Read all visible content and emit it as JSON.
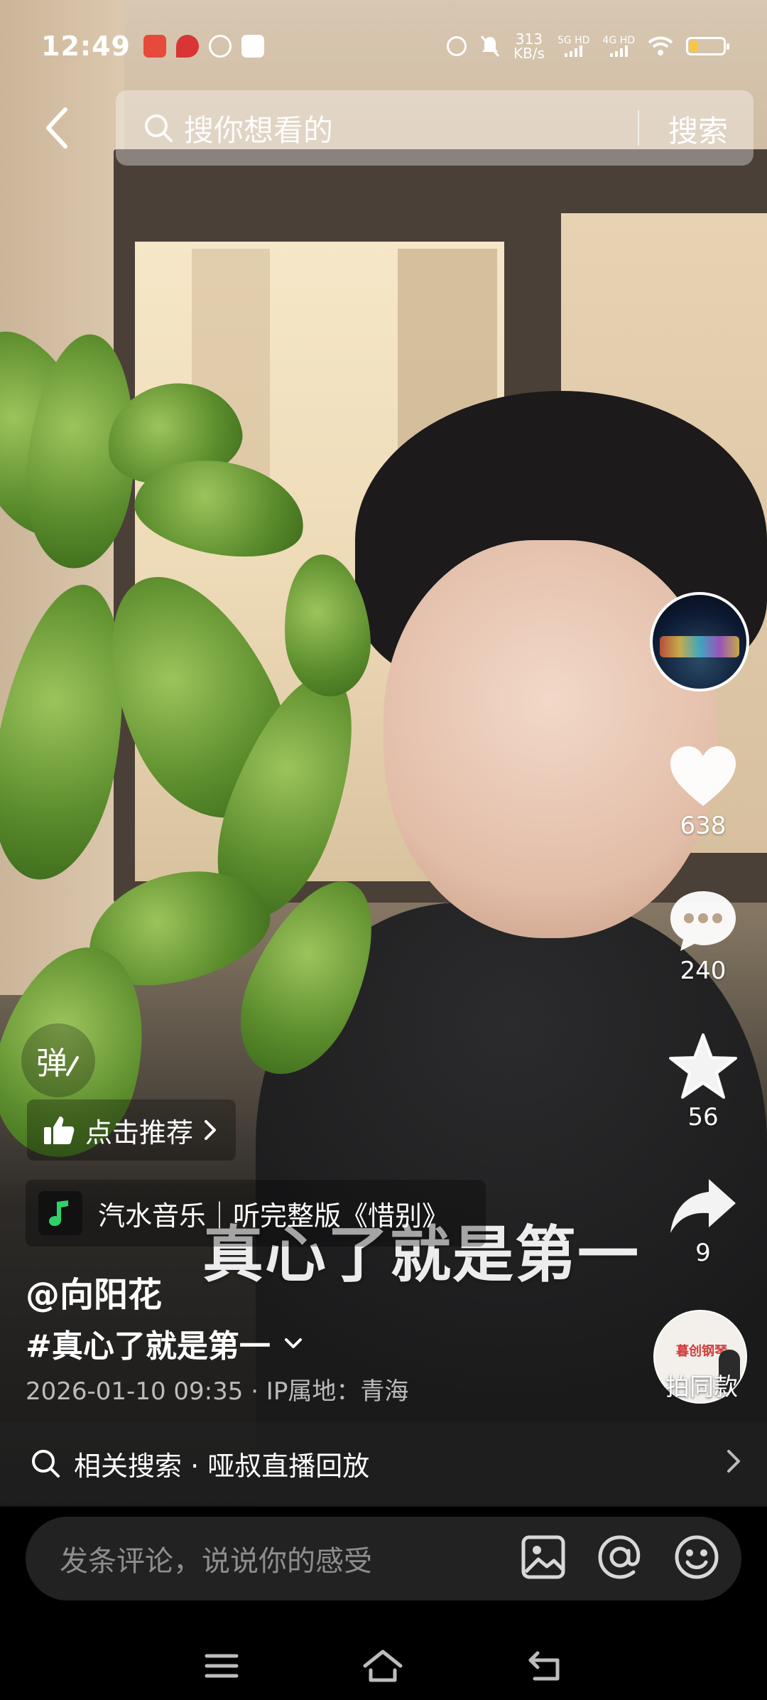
{
  "status_bar": {
    "time": "12:49",
    "net_speed_value": "313",
    "net_speed_unit": "KB/s",
    "sim1": "5G HD",
    "sim2": "4G HD",
    "battery_level": 0.25
  },
  "search": {
    "placeholder": "搜你想看的",
    "button_label": "搜索"
  },
  "right_rail": {
    "like_count": "638",
    "comment_count": "240",
    "favorite_count": "56",
    "share_count": "9",
    "same_style_label": "拍同款",
    "same_style_brand": "暮创钢琴"
  },
  "left_overlay": {
    "danmu_label": "弹",
    "recommend_label": "点击推荐",
    "music_text": "汽水音乐｜听完整版《惜别》",
    "caption_overlay": "真心了就是第一",
    "author": "@向阳花",
    "hashtag": "#真心了就是第一",
    "meta": "2026-01-10 09:35 · IP属地：青海"
  },
  "related_search": {
    "text": "相关搜索 · 哑叔直播回放"
  },
  "comment_bar": {
    "placeholder": "发条评论，说说你的感受"
  },
  "colors": {
    "battery_fill": "#f7c742",
    "music_logo_green": "#2fd16b"
  }
}
